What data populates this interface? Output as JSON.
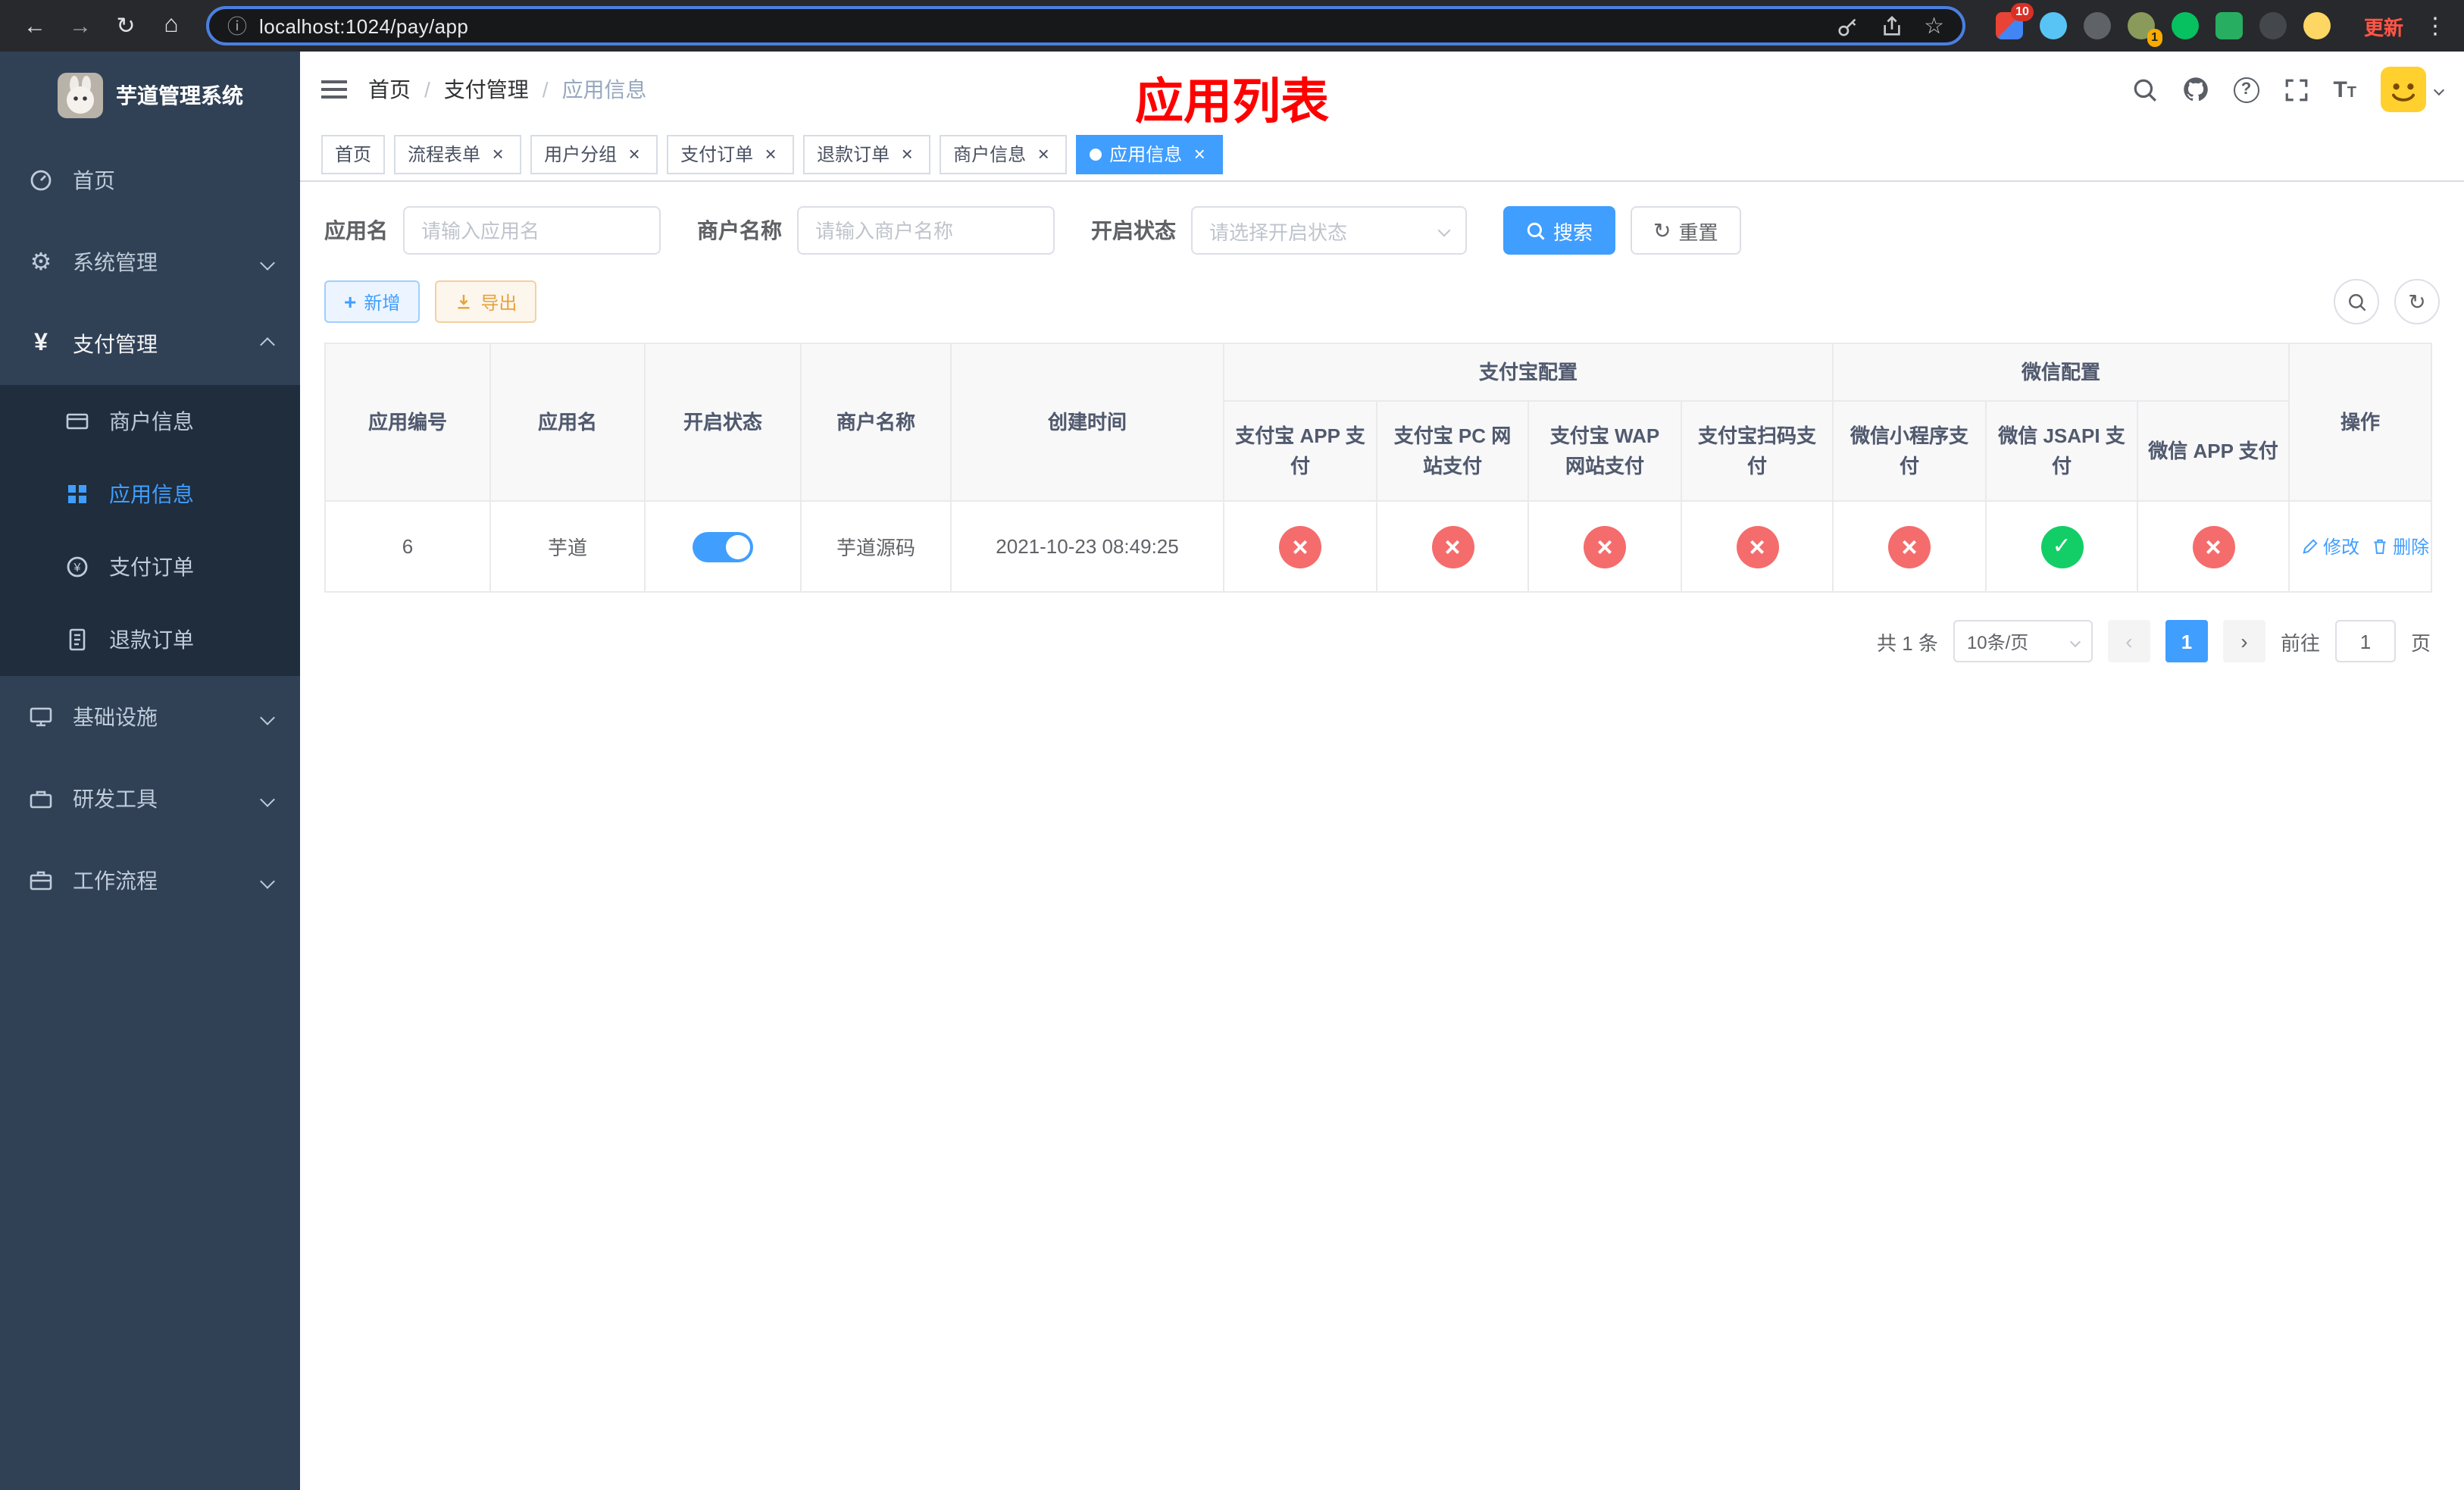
{
  "browser": {
    "url": "localhost:1024/pay/app",
    "update_label": "更新",
    "grid_badge": "10",
    "avatar_badge": "1"
  },
  "sidebar": {
    "title": "芋道管理系统",
    "items": [
      "首页",
      "系统管理",
      "支付管理",
      "基础设施",
      "研发工具",
      "工作流程"
    ],
    "pay_children": [
      "商户信息",
      "应用信息",
      "支付订单",
      "退款订单"
    ]
  },
  "header": {
    "breadcrumb": [
      "首页",
      "支付管理",
      "应用信息"
    ],
    "overlay_title": "应用列表"
  },
  "tabs": {
    "labels": [
      "首页",
      "流程表单",
      "用户分组",
      "支付订单",
      "退款订单",
      "商户信息",
      "应用信息"
    ]
  },
  "filters": {
    "app_name_label": "应用名",
    "app_name_placeholder": "请输入应用名",
    "merchant_label": "商户名称",
    "merchant_placeholder": "请输入商户名称",
    "status_label": "开启状态",
    "status_placeholder": "请选择开启状态",
    "search_label": "搜索",
    "reset_label": "重置"
  },
  "toolbar": {
    "add": "新增",
    "export": "导出"
  },
  "table": {
    "cols": [
      "应用编号",
      "应用名",
      "开启状态",
      "商户名称",
      "创建时间"
    ],
    "group_alipay": "支付宝配置",
    "group_wechat": "微信配置",
    "sub_cols": [
      "支付宝 APP 支付",
      "支付宝 PC 网站支付",
      "支付宝 WAP 网站支付",
      "支付宝扫码支付",
      "微信小程序支付",
      "微信 JSAPI 支付",
      "微信 APP 支付"
    ],
    "col_actions": "操作",
    "row": {
      "id": "6",
      "name": "芋道",
      "switch": "on",
      "merchant": "芋道源码",
      "created": "2021-10-23 08:49:25",
      "statuses": [
        "fail",
        "fail",
        "fail",
        "fail",
        "fail",
        "success",
        "fail"
      ],
      "edit": "修改",
      "delete": "删除"
    }
  },
  "pagination": {
    "total": "共 1 条",
    "size": "10条/页",
    "page": "1",
    "goto": "前往",
    "unit": "页",
    "goto_value": "1"
  },
  "colors": {
    "primary": "#409eff",
    "fail": "#f56c6c",
    "success": "#13ce66",
    "sidebar_bg": "#304156",
    "sidebar_sub_bg": "#1f2d3d",
    "annotation_red": "#ff0000"
  }
}
